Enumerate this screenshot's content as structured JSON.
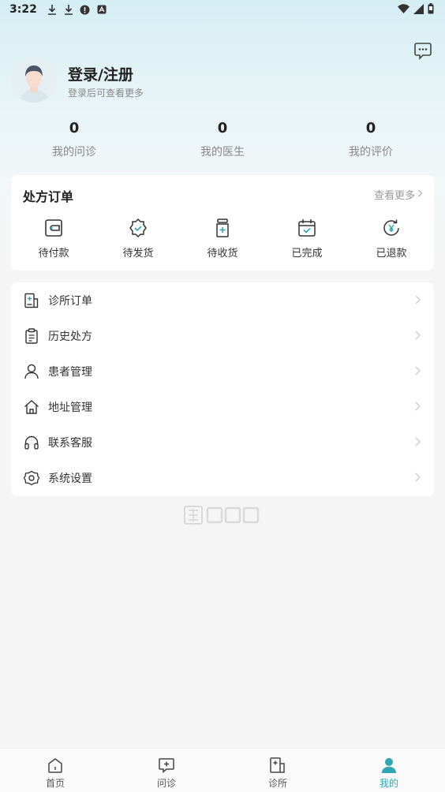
{
  "status_bar": {
    "time": "3:22"
  },
  "user": {
    "name": "登录/注册",
    "subtitle": "登录后可查看更多"
  },
  "stats": [
    {
      "value": "0",
      "label": "我的问诊"
    },
    {
      "value": "0",
      "label": "我的医生"
    },
    {
      "value": "0",
      "label": "我的评价"
    }
  ],
  "orders": {
    "title": "处方订单",
    "more": "查看更多",
    "items": [
      {
        "label": "待付款",
        "icon": "wallet-icon"
      },
      {
        "label": "待发货",
        "icon": "badge-check-icon"
      },
      {
        "label": "待收货",
        "icon": "medicine-bottle-icon"
      },
      {
        "label": "已完成",
        "icon": "calendar-check-icon"
      },
      {
        "label": "已退款",
        "icon": "refund-yen-icon"
      }
    ]
  },
  "menu": [
    {
      "label": "诊所订单",
      "icon": "clinic-icon"
    },
    {
      "label": "历史处方",
      "icon": "clipboard-icon"
    },
    {
      "label": "患者管理",
      "icon": "person-icon"
    },
    {
      "label": "地址管理",
      "icon": "home-icon"
    },
    {
      "label": "联系客服",
      "icon": "headset-icon"
    },
    {
      "label": "系统设置",
      "icon": "gear-icon"
    }
  ],
  "tabbar": [
    {
      "label": "首页",
      "icon": "home-tab-icon"
    },
    {
      "label": "问诊",
      "icon": "consult-tab-icon"
    },
    {
      "label": "诊所",
      "icon": "clinic-tab-icon"
    },
    {
      "label": "我的",
      "icon": "profile-tab-icon"
    }
  ],
  "colors": {
    "accent": "#2fa6b4",
    "text": "#222222",
    "muted": "#888888",
    "background": "#f5f5f5"
  }
}
